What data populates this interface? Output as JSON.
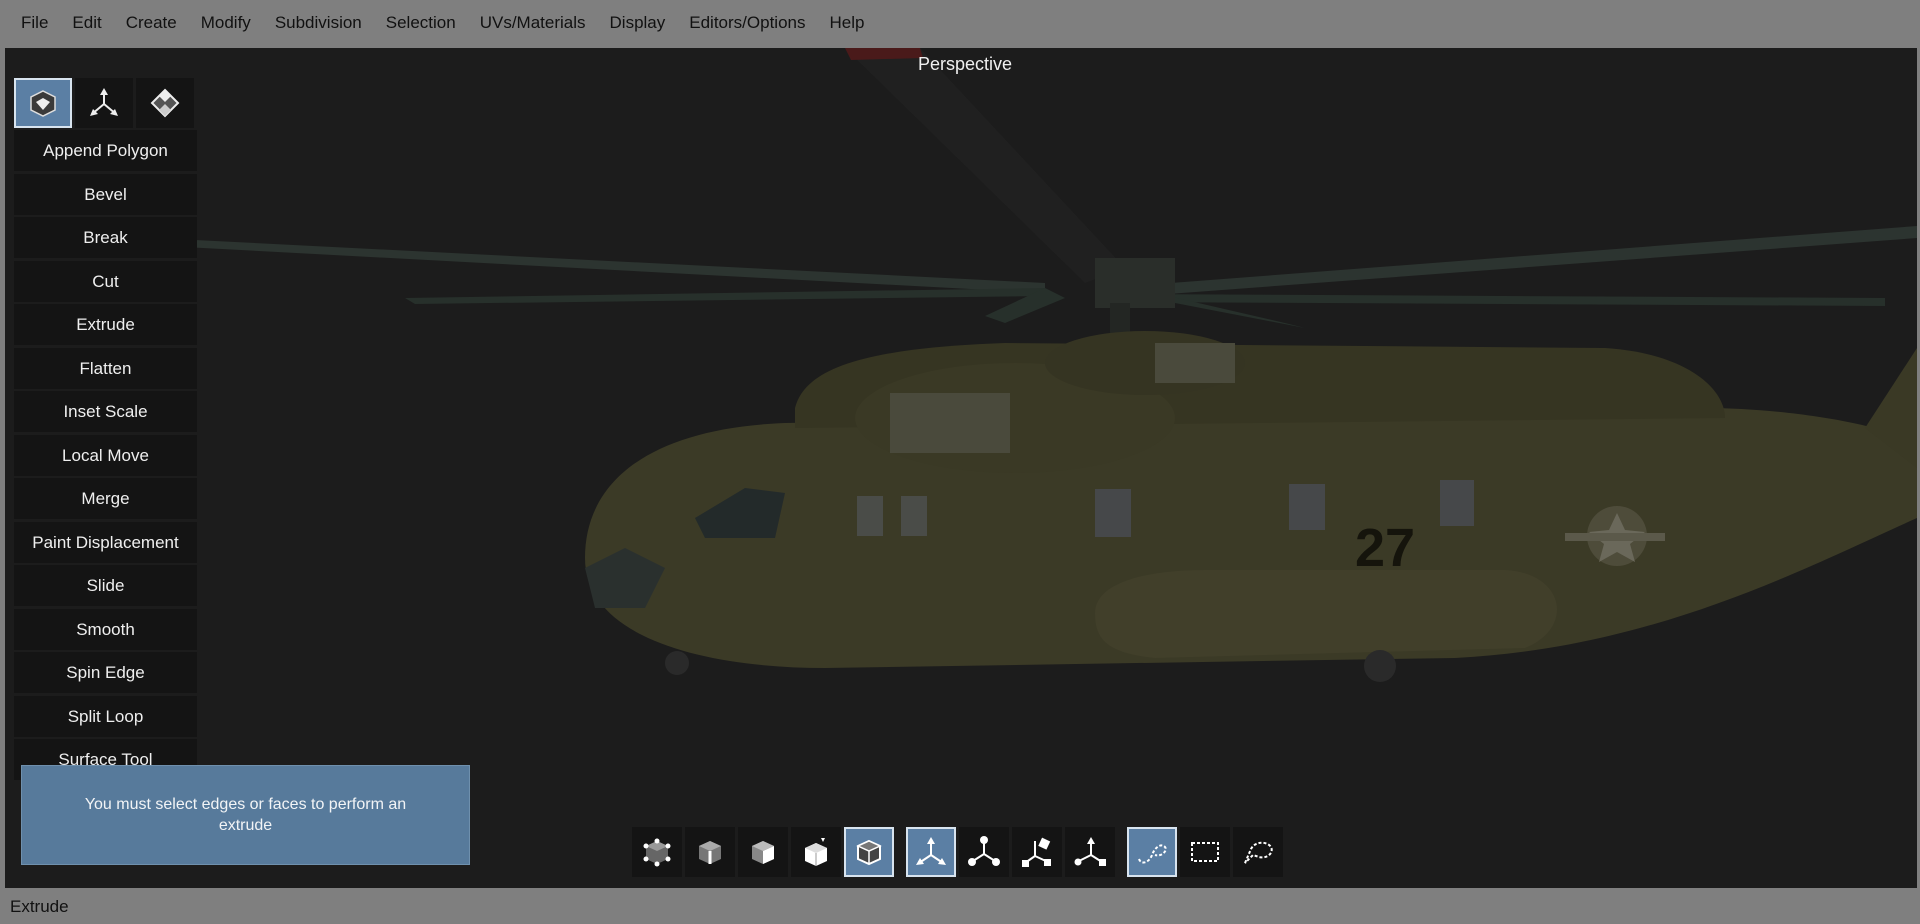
{
  "menu": [
    "File",
    "Edit",
    "Create",
    "Modify",
    "Subdivision",
    "Selection",
    "UVs/Materials",
    "Display",
    "Editors/Options",
    "Help"
  ],
  "viewport": {
    "label": "Perspective",
    "model_marking": "27"
  },
  "mode_icons": [
    "polygon-mode-icon",
    "transform-mode-icon",
    "uv-mode-icon"
  ],
  "tools": [
    "Append Polygon",
    "Bevel",
    "Break",
    "Cut",
    "Extrude",
    "Flatten",
    "Inset Scale",
    "Local Move",
    "Merge",
    "Paint Displacement",
    "Slide",
    "Smooth",
    "Spin Edge",
    "Split Loop",
    "Surface Tool"
  ],
  "message": "You must select edges or faces to perform an extrude",
  "bottom_toolbar": {
    "component_icons": [
      "vertex-select-icon",
      "edge-select-icon",
      "face-select-icon",
      "object-select-icon",
      "multi-select-icon"
    ],
    "transform_icons": [
      "move-icon",
      "scale-icon",
      "rotate-icon",
      "universal-manipulator-icon"
    ],
    "selection_icons": [
      "lasso-select-icon",
      "box-select-icon",
      "freeform-select-icon"
    ]
  },
  "status": "Extrude",
  "colors": {
    "accent": "#5b7fa4",
    "message_bg": "#577a9b",
    "viewport_bg": "#1c1c1c",
    "chrome": "#7f7f7f"
  }
}
